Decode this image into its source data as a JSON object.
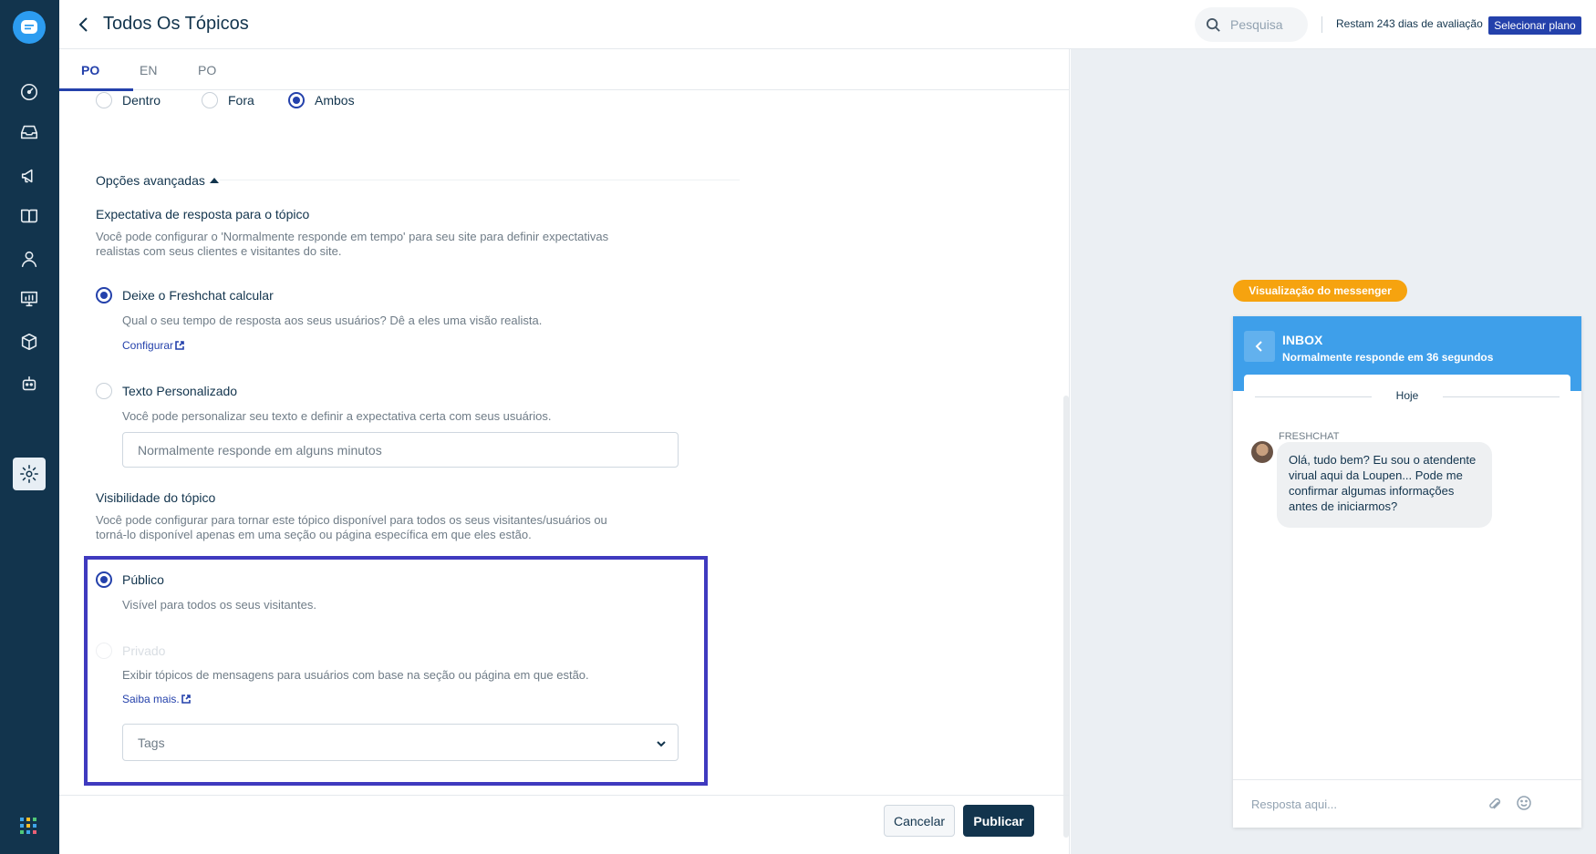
{
  "header": {
    "title": "Todos Os Tópicos",
    "search_placeholder": "Pesquisa",
    "trial_text": "Restam 243 dias de avaliação",
    "plan_button": "Selecionar plano"
  },
  "tabs": [
    "PO",
    "EN",
    "PO"
  ],
  "location_options": [
    "Dentro",
    "Fora",
    "Ambos"
  ],
  "advanced": {
    "toggle_label": "Opções avançadas",
    "response_title": "Expectativa de resposta para o tópico",
    "response_desc_1": "Você pode configurar o 'Normalmente responde em tempo' para seu site para definir expectativas",
    "response_desc_2": "realistas com seus clientes e visitantes do site.",
    "option_calc_label": "Deixe o Freshchat calcular",
    "option_calc_desc": "Qual o seu tempo de resposta aos seus usuários? Dê a eles uma visão realista.",
    "option_calc_link": "Configurar",
    "option_custom_label": "Texto Personalizado",
    "option_custom_desc": "Você pode personalizar seu texto e definir a expectativa certa com seus usuários.",
    "custom_placeholder": "Normalmente responde em alguns minutos"
  },
  "visibility": {
    "title": "Visibilidade do tópico",
    "desc_1": "Você pode configurar para tornar este tópico disponível para todos os seus visitantes/usuários ou",
    "desc_2": "torná-lo disponível apenas em uma seção ou página específica em que eles estão.",
    "public_label": "Público",
    "public_desc": "Visível para todos os seus visitantes.",
    "private_label": "Privado",
    "private_desc": "Exibir tópicos de mensagens para usuários com base na seção ou página em que estão.",
    "private_link": "Saiba mais.",
    "tags_placeholder": "Tags"
  },
  "footer": {
    "cancel": "Cancelar",
    "publish": "Publicar"
  },
  "preview": {
    "badge": "Visualização do messenger",
    "inbox_title": "INBOX",
    "inbox_subtitle": "Normalmente responde em 36 segundos",
    "day_label": "Hoje",
    "sender": "FRESHCHAT",
    "message": "Olá, tudo bem? Eu sou o atendente virual aqui da Loupen... Pode me confirmar algumas informações antes de iniciarmos?",
    "reply_placeholder": "Resposta aqui..."
  },
  "colors": {
    "nav_bg": "#12344d",
    "accent": "#2441ab",
    "badge": "#f6a30f",
    "messenger_header": "#3e9fea",
    "highlight_border": "#3f3abf"
  }
}
